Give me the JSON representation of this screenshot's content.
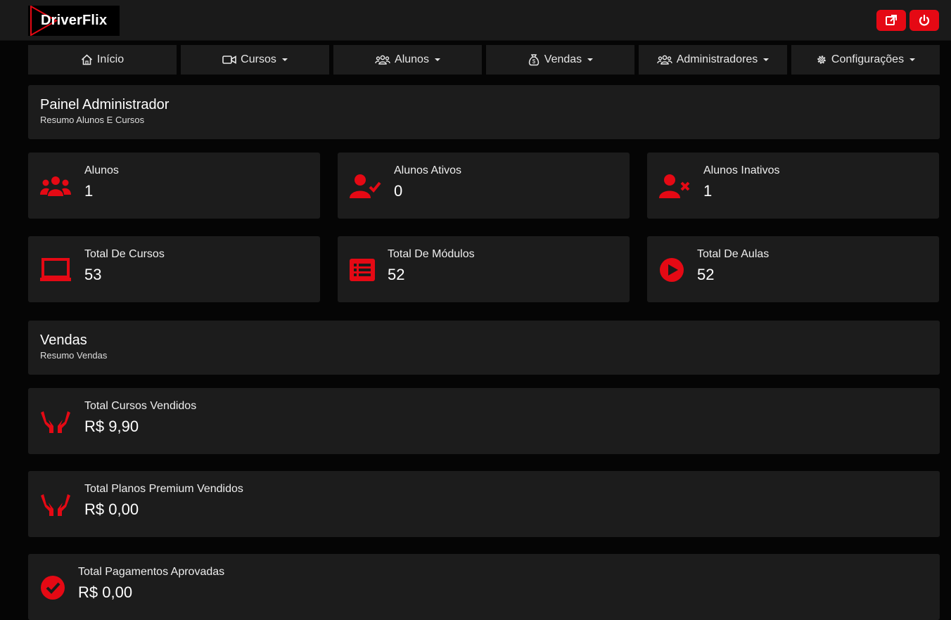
{
  "brand": {
    "name": "DriverFlix",
    "accent": "#e50914"
  },
  "topbar": {
    "external_icon": "external-link-icon",
    "power_icon": "power-icon"
  },
  "nav": [
    {
      "label": "Início",
      "icon": "home-icon"
    },
    {
      "label": "Cursos",
      "icon": "video-icon"
    },
    {
      "label": "Alunos",
      "icon": "users-icon"
    },
    {
      "label": "Vendas",
      "icon": "money-bag-icon"
    },
    {
      "label": "Administradores",
      "icon": "users-cog-icon"
    },
    {
      "label": "Configurações",
      "icon": "gear-icon"
    }
  ],
  "painel": {
    "title": "Painel Administrador",
    "subtitle": "Resumo Alunos E Cursos"
  },
  "stats": [
    {
      "label": "Alunos",
      "value": "1",
      "icon": "users-icon"
    },
    {
      "label": "Alunos Ativos",
      "value": "0",
      "icon": "user-check-icon"
    },
    {
      "label": "Alunos Inativos",
      "value": "1",
      "icon": "user-x-icon"
    },
    {
      "label": "Total De Cursos",
      "value": "53",
      "icon": "laptop-icon"
    },
    {
      "label": "Total De Módulos",
      "value": "52",
      "icon": "list-icon"
    },
    {
      "label": "Total De Aulas",
      "value": "52",
      "icon": "play-circle-icon"
    }
  ],
  "vendas": {
    "title": "Vendas",
    "subtitle": "Resumo Vendas"
  },
  "sales": [
    {
      "label": "Total Cursos Vendidos",
      "value": "R$ 9,90",
      "icon": "hands-icon"
    },
    {
      "label": "Total Planos Premium Vendidos",
      "value": "R$ 0,00",
      "icon": "hands-icon"
    },
    {
      "label": "Total Pagamentos Aprovadas",
      "value": "R$ 0,00",
      "icon": "check-circle-icon"
    }
  ]
}
